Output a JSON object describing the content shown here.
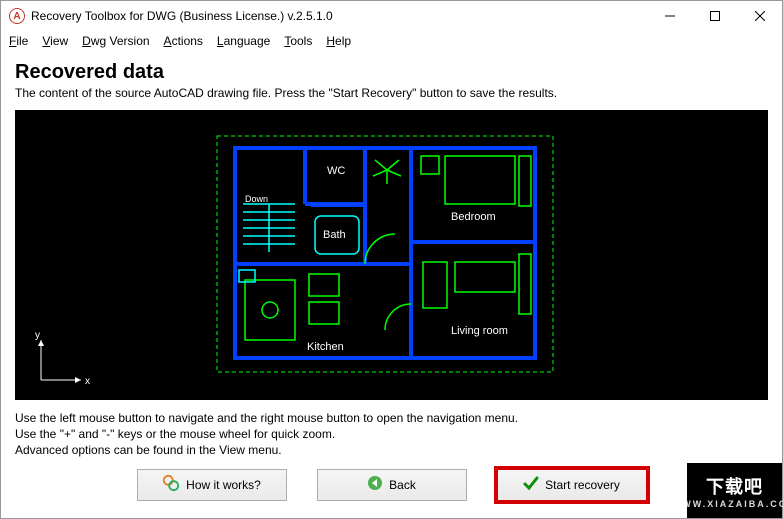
{
  "window": {
    "title": "Recovery Toolbox for DWG (Business License.) v.2.5.1.0"
  },
  "menu": {
    "file": "File",
    "view": "View",
    "dwg": "Dwg Version",
    "actions": "Actions",
    "language": "Language",
    "tools": "Tools",
    "help": "Help"
  },
  "header": {
    "title": "Recovered data",
    "subtitle": "The content of the source AutoCAD drawing file. Press the \"Start Recovery\" button to save the results."
  },
  "plan": {
    "wc": "WC",
    "bath": "Bath",
    "bedroom": "Bedroom",
    "kitchen": "Kitchen",
    "living": "Living room",
    "down": "Down"
  },
  "axis": {
    "x": "x",
    "y": "y"
  },
  "help": {
    "line1": "Use the left mouse button to navigate and the right mouse button to open the navigation menu.",
    "line2": "Use the \"+\" and \"-\" keys or the mouse wheel for quick zoom.",
    "line3": "Advanced options can be found in the View menu."
  },
  "buttons": {
    "how": "How it works?",
    "back": "Back",
    "start": "Start recovery"
  },
  "watermark": {
    "big": "下载吧",
    "small": "WWW.XIAZAIBA.COM"
  }
}
